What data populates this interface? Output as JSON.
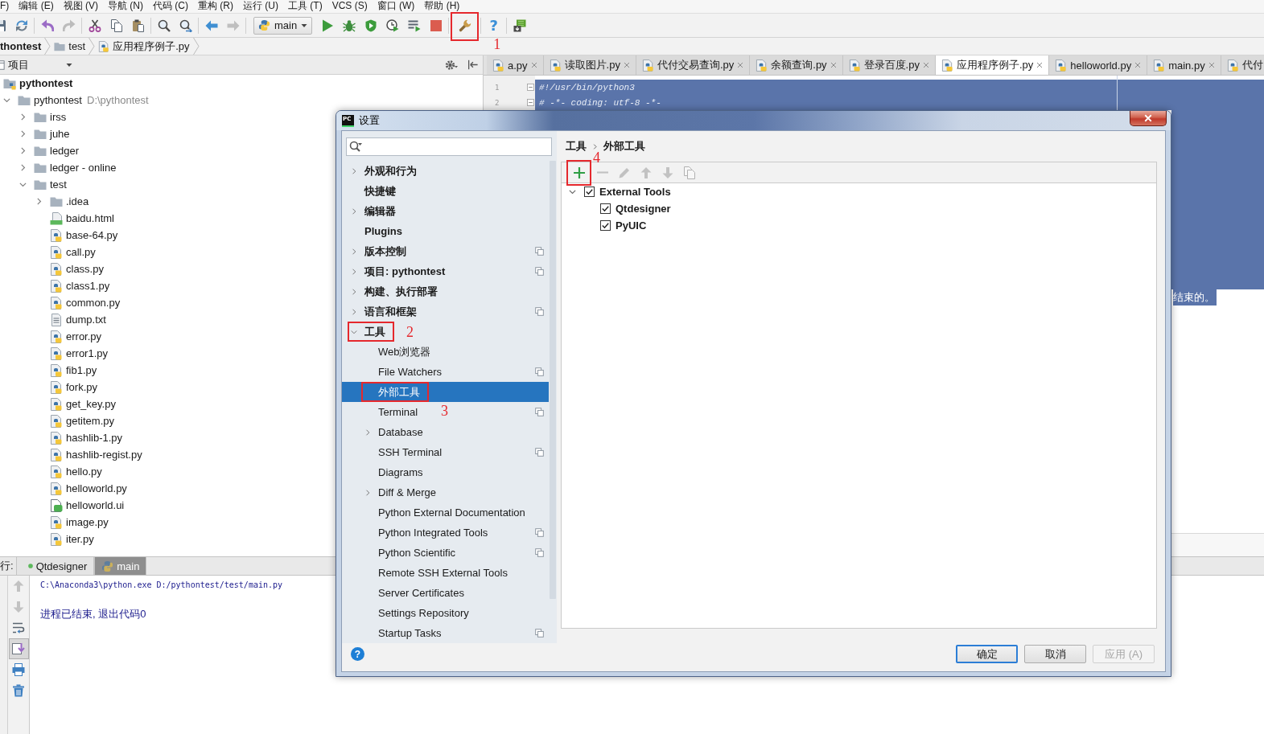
{
  "menu_bar": {
    "items": [
      "F)",
      "编辑 (E)",
      "视图 (V)",
      "导航 (N)",
      "代码 (C)",
      "重构 (R)",
      "运行 (U)",
      "工具 (T)",
      "VCS (S)",
      "窗口 (W)",
      "帮助 (H)"
    ]
  },
  "toolbar": {
    "groups": [
      [
        {
          "kind": "icon",
          "disabled": false
        },
        {
          "kind": "icon",
          "disabled": false
        }
      ],
      [
        {
          "kind": "icon",
          "disabled": false
        },
        {
          "kind": "icon",
          "disabled": true
        }
      ],
      [
        {
          "kind": "icon",
          "disabled": false
        },
        {
          "kind": "icon",
          "disabled": false
        },
        {
          "kind": "icon",
          "disabled": false
        }
      ],
      [
        {
          "kind": "icon",
          "disabled": false
        },
        {
          "kind": "icon",
          "disabled": false
        }
      ],
      [
        {
          "kind": "icon",
          "disabled": false
        },
        {
          "kind": "icon",
          "disabled": true
        }
      ],
      [
        {
          "kind": "dropdown",
          "label": "main"
        },
        {
          "kind": "icon",
          "disabled": false
        },
        {
          "kind": "icon",
          "disabled": false
        },
        {
          "kind": "icon",
          "disabled": false
        },
        {
          "kind": "icon",
          "disabled": false
        },
        {
          "kind": "icon",
          "disabled": false
        },
        {
          "kind": "icon",
          "disabled": false
        }
      ],
      [
        {
          "kind": "icon",
          "disabled": false,
          "annotation": "1"
        }
      ],
      [
        {
          "kind": "text",
          "label": "?"
        }
      ],
      [
        {
          "kind": "icon",
          "disabled": false
        }
      ]
    ]
  },
  "navigation_bar": {
    "items": [
      {
        "kind": "project",
        "label": "thontest"
      },
      {
        "kind": "folder",
        "label": "test"
      },
      {
        "kind": "python",
        "label": "应用程序例子.py"
      }
    ]
  },
  "project_panel": {
    "title": "项目",
    "tree": [
      {
        "label": "pythontest",
        "kind": "project",
        "children": [
          {
            "label": "pythontest",
            "path": "D:\\pythontest",
            "kind": "folder",
            "expanded": true,
            "children": [
              {
                "label": "irss",
                "kind": "folder",
                "expanded": false
              },
              {
                "label": "juhe",
                "kind": "folder",
                "expanded": false
              },
              {
                "label": "ledger",
                "kind": "folder",
                "expanded": false
              },
              {
                "label": "ledger - online",
                "kind": "folder",
                "expanded": false
              },
              {
                "label": "test",
                "kind": "folder",
                "expanded": true,
                "children": [
                  {
                    "label": ".idea",
                    "kind": "folder",
                    "expanded": false
                  },
                  {
                    "label": "baidu.html",
                    "kind": "html"
                  },
                  {
                    "label": "base-64.py",
                    "kind": "python"
                  },
                  {
                    "label": "call.py",
                    "kind": "python"
                  },
                  {
                    "label": "class.py",
                    "kind": "python"
                  },
                  {
                    "label": "class1.py",
                    "kind": "python"
                  },
                  {
                    "label": "common.py",
                    "kind": "python"
                  },
                  {
                    "label": "dump.txt",
                    "kind": "text"
                  },
                  {
                    "label": "error.py",
                    "kind": "python"
                  },
                  {
                    "label": "error1.py",
                    "kind": "python"
                  },
                  {
                    "label": "fib1.py",
                    "kind": "python"
                  },
                  {
                    "label": "fork.py",
                    "kind": "python"
                  },
                  {
                    "label": "get_key.py",
                    "kind": "python"
                  },
                  {
                    "label": "getitem.py",
                    "kind": "python"
                  },
                  {
                    "label": "hashlib-1.py",
                    "kind": "python"
                  },
                  {
                    "label": "hashlib-regist.py",
                    "kind": "python"
                  },
                  {
                    "label": "hello.py",
                    "kind": "python"
                  },
                  {
                    "label": "helloworld.py",
                    "kind": "python"
                  },
                  {
                    "label": "helloworld.ui",
                    "kind": "ui"
                  },
                  {
                    "label": "image.py",
                    "kind": "python"
                  },
                  {
                    "label": "iter.py",
                    "kind": "python"
                  }
                ]
              }
            ]
          }
        ]
      }
    ]
  },
  "editor": {
    "tabs": [
      {
        "label": "a.py",
        "selected": false
      },
      {
        "label": "读取图片.py",
        "selected": false
      },
      {
        "label": "代付交易查询.py",
        "selected": false
      },
      {
        "label": "余额查询.py",
        "selected": false
      },
      {
        "label": "登录百度.py",
        "selected": false
      },
      {
        "label": "应用程序例子.py",
        "selected": true
      },
      {
        "label": "helloworld.py",
        "selected": false
      },
      {
        "label": "main.py",
        "selected": false
      },
      {
        "label": "代付",
        "selected": false
      }
    ],
    "all_selected": true,
    "lines": [
      {
        "number": "1",
        "text": "#!/usr/bin/python3",
        "fold_marker": true
      },
      {
        "number": "2",
        "text": "# -*- coding: utf-8 -*-",
        "fold_marker": true
      }
    ],
    "last_line_fragment": "结束的。"
  },
  "run_panel": {
    "label": "行:",
    "tabs": [
      {
        "label": "Qtdesigner",
        "kind": "tool",
        "selected": false
      },
      {
        "label": "main",
        "kind": "python",
        "selected": true
      }
    ],
    "toolbar": [
      {
        "disabled": true,
        "on": false
      },
      {
        "disabled": true,
        "on": false
      },
      {
        "disabled": false,
        "on": false
      },
      {
        "disabled": false,
        "on": true
      },
      {
        "disabled": false,
        "on": false
      },
      {
        "disabled": false,
        "on": false
      }
    ],
    "console": [
      {
        "kind": "command",
        "text": "C:\\Anaconda3\\python.exe D:/pythontest/test/main.py"
      },
      {
        "kind": "message",
        "text": "进程已结束, 退出代码0"
      }
    ]
  },
  "settings_dialog": {
    "title": "设置",
    "logo_text": "PC",
    "nav": [
      {
        "label": "外观和行为",
        "expanded": false,
        "selected": false
      },
      {
        "label": "快捷键",
        "selected": false
      },
      {
        "label": "编辑器",
        "expanded": false,
        "selected": false
      },
      {
        "label": "Plugins",
        "selected": false
      },
      {
        "label": "版本控制",
        "expanded": false,
        "per_project": true,
        "selected": false
      },
      {
        "label": "项目: pythontest",
        "expanded": false,
        "per_project": true,
        "selected": false
      },
      {
        "label": "构建、执行部署",
        "expanded": false,
        "selected": false
      },
      {
        "label": "语言和框架",
        "expanded": false,
        "per_project": true,
        "selected": false
      },
      {
        "label": "工具",
        "expanded": true,
        "selected": false,
        "annotation": "2",
        "children": [
          {
            "label": "Web浏览器",
            "selected": false
          },
          {
            "label": "File Watchers",
            "per_project": true,
            "selected": false
          },
          {
            "label": "外部工具",
            "selected": true,
            "annotation": "3"
          },
          {
            "label": "Terminal",
            "per_project": true,
            "selected": false
          },
          {
            "label": "Database",
            "expanded": false,
            "selected": false
          },
          {
            "label": "SSH Terminal",
            "per_project": true,
            "selected": false
          },
          {
            "label": "Diagrams",
            "selected": false
          },
          {
            "label": "Diff & Merge",
            "expanded": false,
            "selected": false
          },
          {
            "label": "Python External Documentation",
            "selected": false
          },
          {
            "label": "Python Integrated Tools",
            "per_project": true,
            "selected": false
          },
          {
            "label": "Python Scientific",
            "per_project": true,
            "selected": false
          },
          {
            "label": "Remote SSH External Tools",
            "selected": false
          },
          {
            "label": "Server Certificates",
            "selected": false
          },
          {
            "label": "Settings Repository",
            "selected": false
          },
          {
            "label": "Startup Tasks",
            "per_project": true,
            "selected": false
          }
        ]
      }
    ],
    "breadcrumb": [
      "工具",
      "外部工具"
    ],
    "tools_toolbar": [
      {
        "disabled": false,
        "annotation": "4"
      },
      {
        "disabled": true
      },
      {
        "disabled": true
      },
      {
        "disabled": true
      },
      {
        "disabled": true
      },
      {
        "disabled": true
      }
    ],
    "tools_tree": [
      {
        "label": "External Tools",
        "checked": true,
        "expanded": true,
        "children": [
          {
            "label": "Qtdesigner",
            "checked": true
          },
          {
            "label": "PyUIC",
            "checked": true
          }
        ]
      }
    ],
    "help": "?",
    "buttons": [
      {
        "label": "确定",
        "kind": "default",
        "disabled": false
      },
      {
        "label": "取消",
        "kind": "normal",
        "disabled": false
      },
      {
        "label": "应用 (A)",
        "kind": "normal",
        "disabled": true
      }
    ]
  }
}
